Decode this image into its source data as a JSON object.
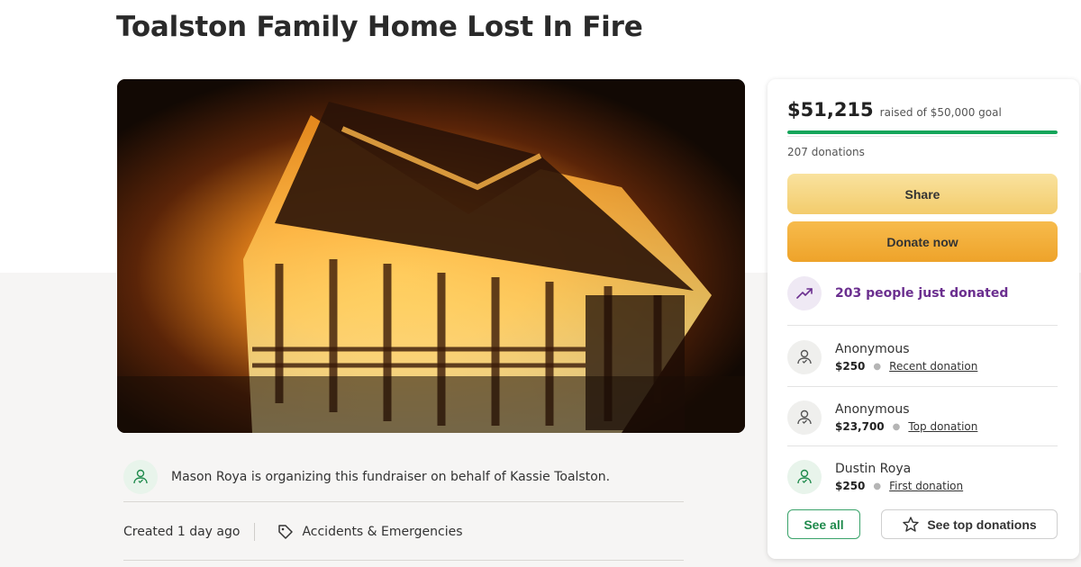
{
  "page": {
    "title": "Toalston Family Home Lost In Fire"
  },
  "organizer": {
    "text": "Mason Roya is organizing this fundraiser on behalf of Kassie Toalston.",
    "icon": "user-heart-icon"
  },
  "meta": {
    "created": "Created 1 day ago",
    "category": "Accidents & Emergencies",
    "category_icon": "tag-icon"
  },
  "donation_card": {
    "raised_amount": "$51,215",
    "raised_goal_text": "raised of $50,000 goal",
    "progress_fraction": 1.0,
    "donations_count": "207 donations",
    "share_label": "Share",
    "donate_label": "Donate now",
    "trend_text": "203 people just donated",
    "trend_icon": "trending-up-icon",
    "donors": [
      {
        "name": "Anonymous",
        "amount": "$250",
        "tag": "Recent donation",
        "avatar_color": "grey"
      },
      {
        "name": "Anonymous",
        "amount": "$23,700",
        "tag": "Top donation",
        "avatar_color": "grey"
      },
      {
        "name": "Dustin Roya",
        "amount": "$250",
        "tag": "First donation",
        "avatar_color": "green"
      }
    ],
    "see_all_label": "See all",
    "see_top_label": "See top donations",
    "see_top_icon": "star-icon"
  },
  "colors": {
    "progress": "#14a55a",
    "share_button": "#f3cc6c",
    "donate_button": "#eea32a",
    "trend_text": "#6b2f8f",
    "see_all": "#1f8a4c"
  }
}
